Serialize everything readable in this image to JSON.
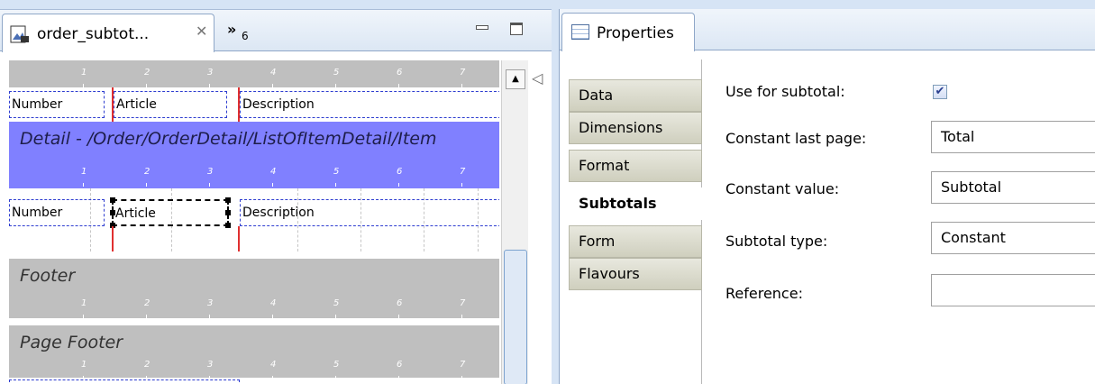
{
  "editor": {
    "tab_title": "order_subtot...",
    "overflow_count": "6"
  },
  "ruler_ticks": [
    "1",
    "2",
    "3",
    "4",
    "5",
    "6",
    "7"
  ],
  "report": {
    "header_fields": {
      "number": "Number",
      "article": "Article",
      "description": "Description"
    },
    "detail_band_title": "Detail - /Order/OrderDetail/ListOfItemDetail/Item",
    "detail_fields": {
      "number": "Number",
      "article": "Article",
      "description": "Description"
    },
    "footer_band_title": "Footer",
    "page_footer_band_title": "Page Footer"
  },
  "properties": {
    "tab_title": "Properties",
    "side_tabs": [
      "Data",
      "Dimensions",
      "Format",
      "Subtotals",
      "Form",
      "Flavours"
    ],
    "active_side_tab": "Subtotals",
    "labels": {
      "use_for_subtotal": "Use for subtotal:",
      "constant_last_page": "Constant last page:",
      "constant_value": "Constant value:",
      "subtotal_type": "Subtotal type:",
      "reference": "Reference:"
    },
    "values": {
      "use_for_subtotal": true,
      "constant_last_page": "Total",
      "constant_value": "Subtotal",
      "subtotal_type": "Constant",
      "reference": ""
    }
  },
  "colors": {
    "detail_band": "#8080ff",
    "band_gray": "#bfbfbf",
    "field_border": "#2e3dd0",
    "column_marker": "#e03030"
  }
}
